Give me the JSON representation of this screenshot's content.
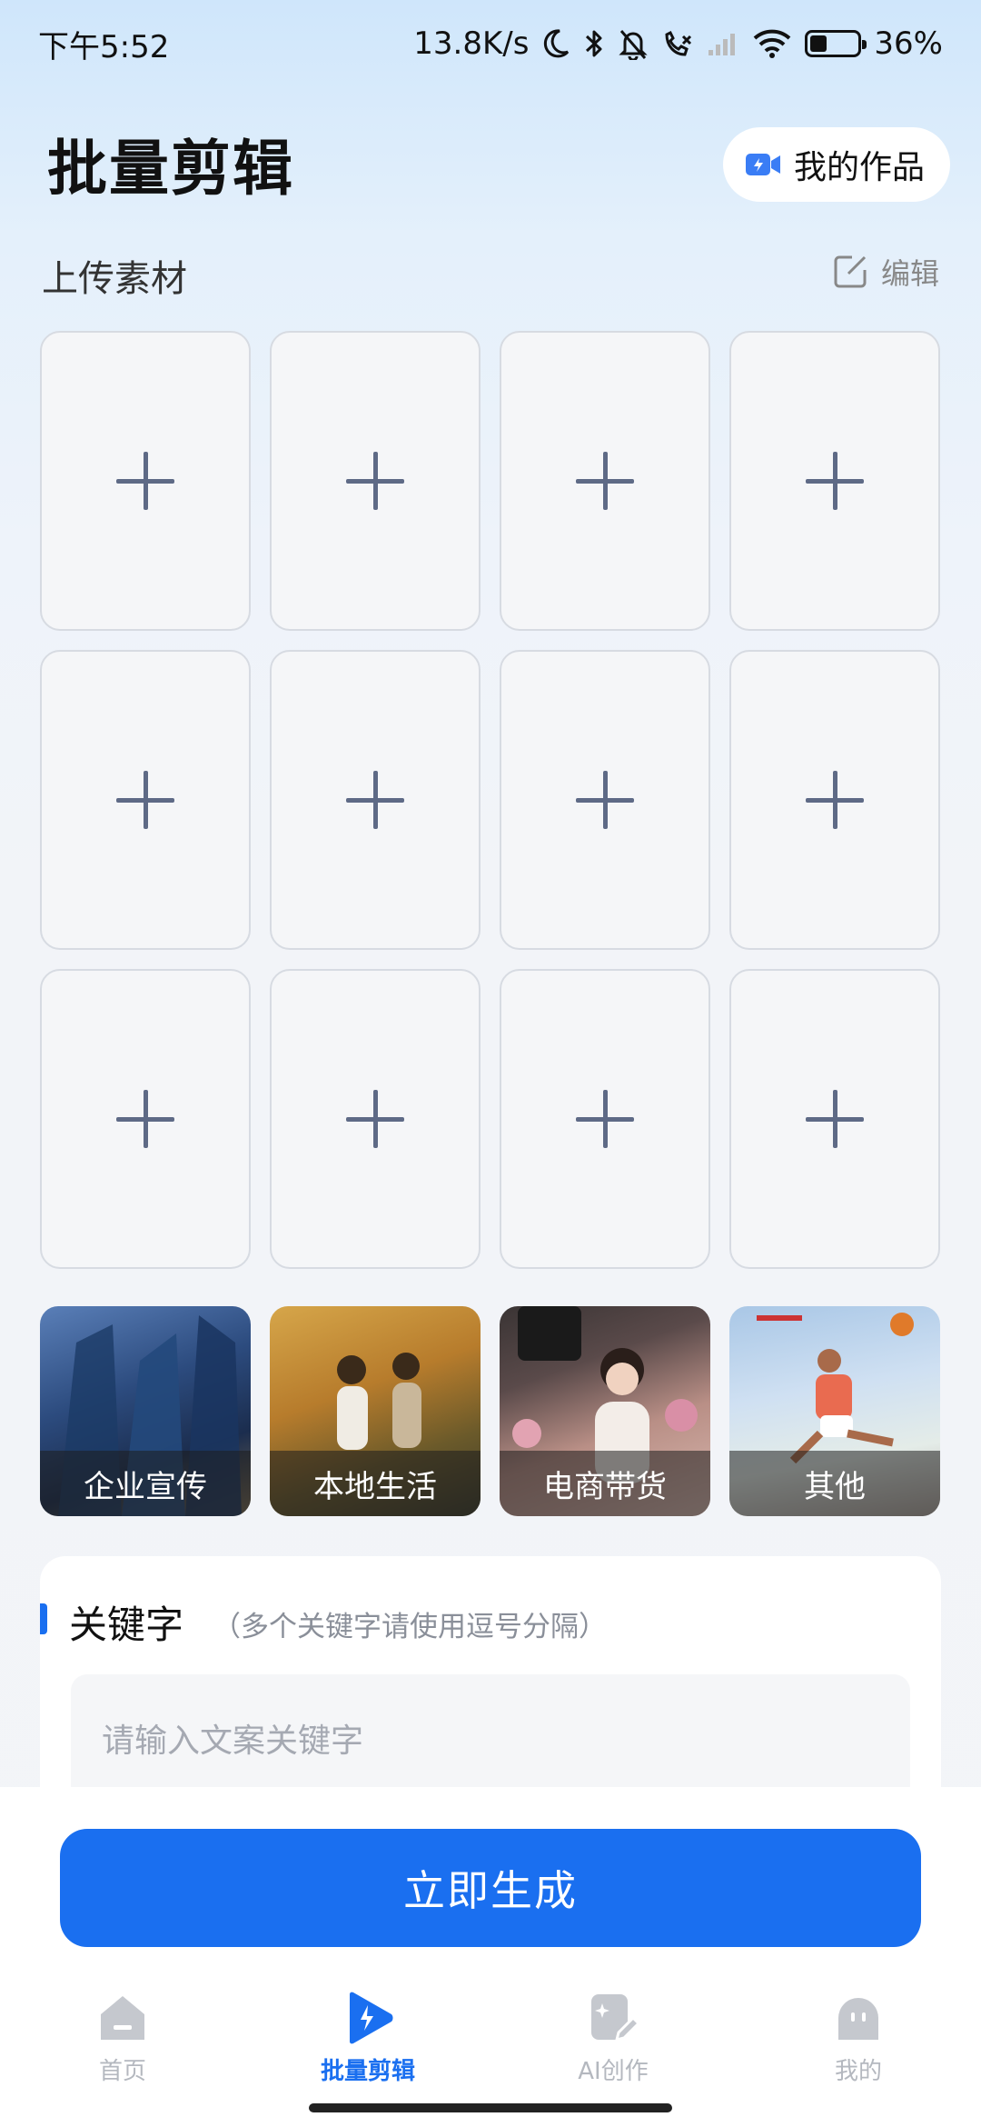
{
  "status_bar": {
    "time": "下午5:52",
    "speed": "13.8K/s",
    "battery_percent": "36%",
    "battery_level": 0.36
  },
  "header": {
    "title": "批量剪辑",
    "works_button": "我的作品"
  },
  "upload": {
    "section_label": "上传素材",
    "edit_label": "编辑",
    "slot_count": 12
  },
  "categories": [
    {
      "label": "企业宣传"
    },
    {
      "label": "本地生活"
    },
    {
      "label": "电商带货"
    },
    {
      "label": "其他"
    }
  ],
  "keyword": {
    "title": "关键字",
    "hint": "（多个关键字请使用逗号分隔）",
    "placeholder": "请输入文案关键字"
  },
  "generate_button": "立即生成",
  "tabs": [
    {
      "label": "首页",
      "icon": "home-icon",
      "active": false
    },
    {
      "label": "批量剪辑",
      "icon": "play-bolt-icon",
      "active": true
    },
    {
      "label": "AI创作",
      "icon": "ai-create-icon",
      "active": false
    },
    {
      "label": "我的",
      "icon": "profile-icon",
      "active": false
    }
  ],
  "colors": {
    "accent": "#1a6ff0",
    "plus": "#5e6a86",
    "tab_inactive": "#b4b8bf"
  }
}
